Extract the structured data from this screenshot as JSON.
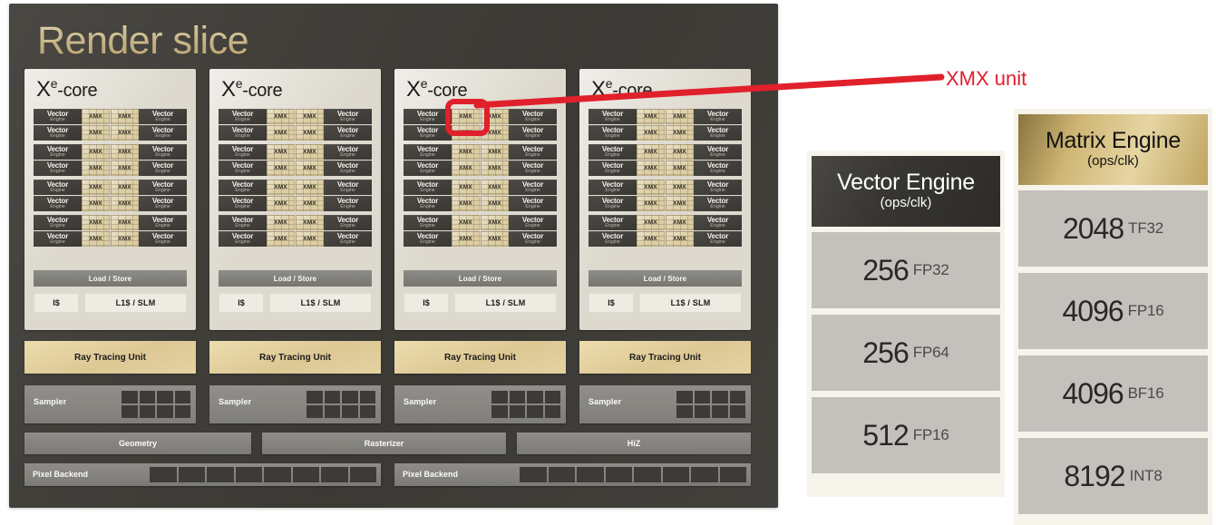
{
  "slice": {
    "title": "Render slice",
    "xe_core_label": {
      "x": "X",
      "sup": "e",
      "suffix": "-core"
    },
    "vector_engine": {
      "line1": "Vector",
      "line2": "Engine"
    },
    "xmx_label": "XMX",
    "load_store": "Load / Store",
    "instruction_cache": "I$",
    "l1_slm": "L1$ / SLM",
    "ray_tracing_unit": "Ray Tracing Unit",
    "sampler": "Sampler",
    "geometry": "Geometry",
    "rasterizer": "Rasterizer",
    "hiz": "HiZ",
    "pixel_backend": "Pixel Backend",
    "xe_core_count": 4,
    "ve_groups_per_core": 4,
    "ve_rows_per_group": 2,
    "sampler_cells": 8,
    "pixel_backend_cells": 8
  },
  "callout": {
    "label": "XMX unit",
    "color": "#e0202b"
  },
  "vector_panel": {
    "title": "Vector Engine",
    "subtitle": "(ops/clk)",
    "header_bg": "#383631",
    "rows": [
      {
        "value": "256",
        "unit": "FP32"
      },
      {
        "value": "256",
        "unit": "FP64"
      },
      {
        "value": "512",
        "unit": "FP16"
      }
    ]
  },
  "matrix_panel": {
    "title": "Matrix Engine",
    "subtitle": "(ops/clk)",
    "header_bg": "#cfb674",
    "rows": [
      {
        "value": "2048",
        "unit": "TF32"
      },
      {
        "value": "4096",
        "unit": "FP16"
      },
      {
        "value": "4096",
        "unit": "BF16"
      },
      {
        "value": "8192",
        "unit": "INT8"
      }
    ]
  },
  "colors": {
    "slice_bg": "#3f3d38",
    "xecore_bg": "#ddd9ce",
    "xmx_tan": "#dbcda4",
    "vector_engine_dark": "#3a3834",
    "ray_tracing_gold": "#ddc894",
    "metric_cell_gray": "#c3c1bc",
    "panel_cream": "#f7f4ec",
    "title_gold": "#e2cd9a"
  }
}
